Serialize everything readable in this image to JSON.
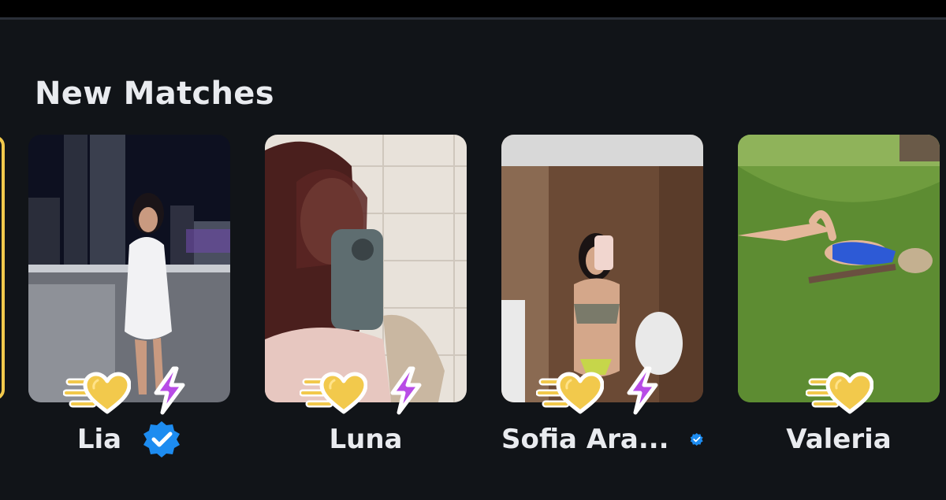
{
  "section": {
    "title": "New Matches"
  },
  "colors": {
    "background": "#111418",
    "text": "#e9ebef",
    "gold": "#f2c94c",
    "boost_purple": "#b84ce6",
    "verified_blue": "#1d8cf0"
  },
  "icons": {
    "like": "super-like-heart-icon",
    "boost": "lightning-bolt-icon",
    "verified": "verified-badge-icon"
  },
  "matches": [
    {
      "name": "Lia",
      "verified": true,
      "has_boost": true
    },
    {
      "name": "Luna",
      "verified": false,
      "has_boost": true
    },
    {
      "name": "Sofia Ara...",
      "verified": true,
      "has_boost": true
    },
    {
      "name": "Valeria",
      "verified": false,
      "has_boost": false
    }
  ]
}
